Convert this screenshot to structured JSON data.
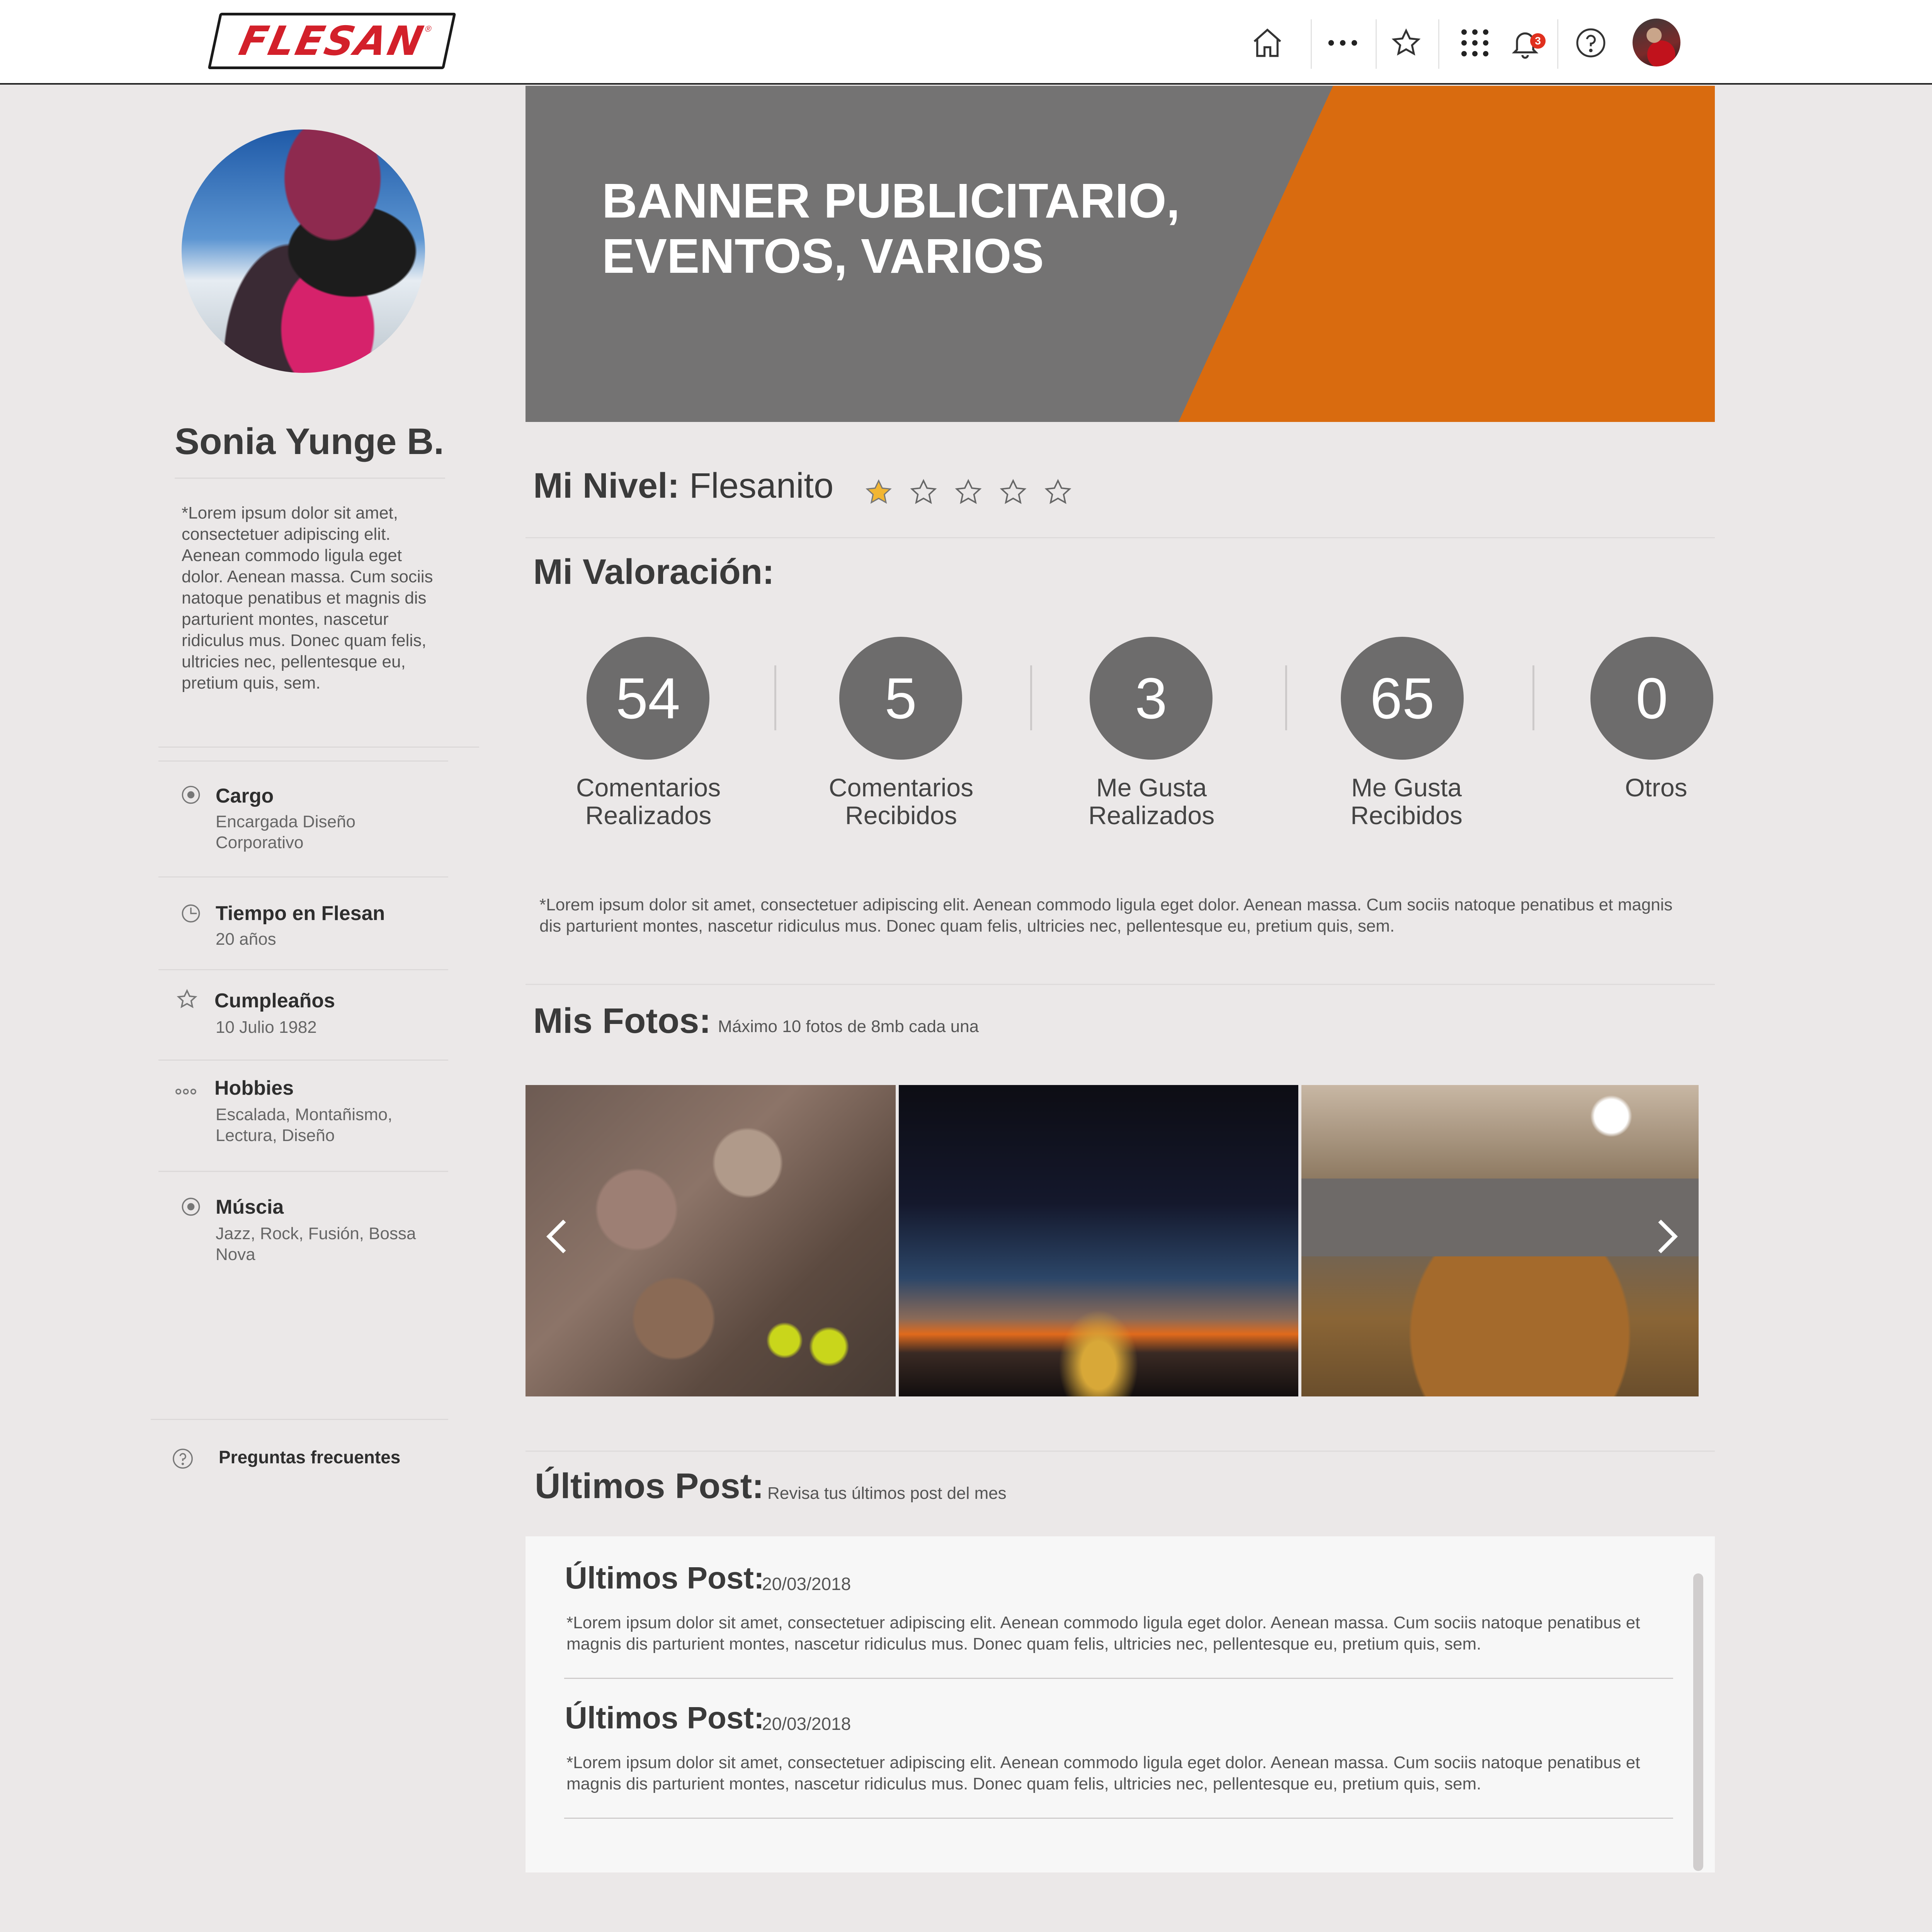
{
  "header": {
    "logo_text": "FLESAN",
    "logo_mark": "®",
    "notification_count": "3",
    "icons": [
      "home-icon",
      "more-icon",
      "star-icon",
      "apps-grid-icon",
      "bell-icon",
      "help-icon",
      "user-avatar"
    ]
  },
  "profile": {
    "name": "Sonia Yunge B.",
    "bio": "*Lorem ipsum dolor sit amet, consectetuer adipiscing elit. Aenean commodo ligula eget dolor. Aenean massa. Cum sociis natoque penatibus et magnis dis parturient montes, nascetur ridiculus mus. Donec quam felis, ultricies nec, pellentesque eu, pretium quis, sem.",
    "info": [
      {
        "label": "Cargo",
        "value": "Encargada Diseño Corporativo",
        "icon": "target-icon"
      },
      {
        "label": "Tiempo en Flesan",
        "value": "20 años",
        "icon": "clock-icon"
      },
      {
        "label": "Cumpleaños",
        "value": "10 Julio 1982",
        "icon": "star-outline-icon"
      },
      {
        "label": "Hobbies",
        "value": "Escalada, Montañismo, Lectura, Diseño",
        "icon": "dots-icon"
      },
      {
        "label": "Múscia",
        "value": "Jazz, Rock, Fusión, Bossa Nova",
        "icon": "disc-icon"
      }
    ],
    "faq_label": "Preguntas frecuentes"
  },
  "banner": {
    "line1": "BANNER PUBLICITARIO,",
    "line2": "EVENTOS, VARIOS",
    "accent_color": "#d96b0f"
  },
  "level": {
    "label": "Mi Nivel:",
    "value": "Flesanito",
    "stars_filled": 1,
    "stars_total": 5
  },
  "valoracion": {
    "title": "Mi Valoración:",
    "stats": [
      {
        "value": "54",
        "line1": "Comentarios",
        "line2": "Realizados"
      },
      {
        "value": "5",
        "line1": "Comentarios",
        "line2": "Recibidos"
      },
      {
        "value": "3",
        "line1": "Me Gusta",
        "line2": "Realizados"
      },
      {
        "value": "65",
        "line1": "Me Gusta",
        "line2": "Recibidos"
      },
      {
        "value": "0",
        "line1": "Otros",
        "line2": ""
      }
    ],
    "description": "*Lorem ipsum dolor sit amet, consectetuer adipiscing elit. Aenean commodo ligula eget dolor. Aenean massa. Cum sociis natoque penatibus et magnis dis parturient montes, nascetur ridiculus mus. Donec quam felis, ultricies nec, pellentesque eu, pretium quis, sem."
  },
  "photos": {
    "title": "Mis Fotos:",
    "subtitle": "Máximo 10 fotos de 8mb cada una"
  },
  "posts": {
    "title": "Últimos Post:",
    "subtitle": "Revisa tus últimos post del mes",
    "items": [
      {
        "title": "Últimos Post:",
        "date": "20/03/2018",
        "text": "*Lorem ipsum dolor sit amet, consectetuer adipiscing elit. Aenean commodo ligula eget dolor. Aenean massa. Cum sociis natoque penatibus et magnis dis parturient montes, nascetur ridiculus mus. Donec quam felis, ultricies nec, pellentesque eu, pretium quis, sem."
      },
      {
        "title": "Últimos Post:",
        "date": "20/03/2018",
        "text": "*Lorem ipsum dolor sit amet, consectetuer adipiscing elit. Aenean commodo ligula eget dolor. Aenean massa. Cum sociis natoque penatibus et magnis dis parturient montes, nascetur ridiculus mus. Donec quam felis, ultricies nec, pellentesque eu, pretium quis, sem."
      }
    ]
  }
}
